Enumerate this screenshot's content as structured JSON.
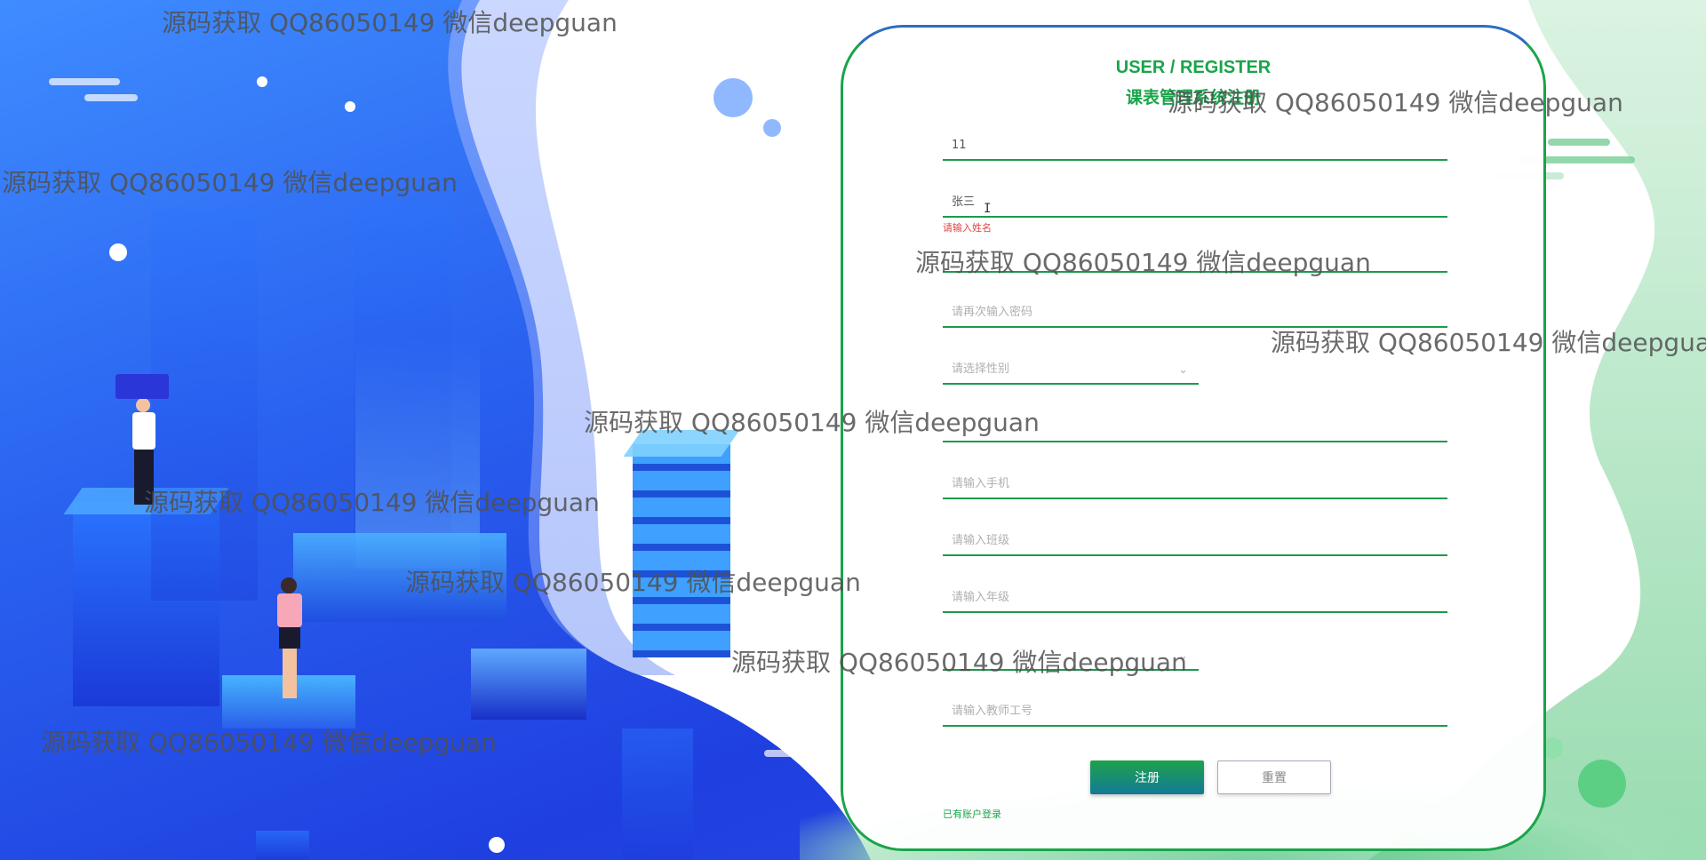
{
  "card": {
    "title_en": "USER / REGISTER",
    "title_cn": "课表管理系统注册"
  },
  "form": {
    "account": {
      "value": "11"
    },
    "name": {
      "value": "张三",
      "error": "请输入姓名"
    },
    "password": {
      "placeholder": ""
    },
    "password_confirm": {
      "placeholder": "请再次输入密码"
    },
    "gender": {
      "placeholder": "请选择性别",
      "chevron": "chevron-down-icon"
    },
    "email": {
      "placeholder": ""
    },
    "phone": {
      "placeholder": "请输入手机"
    },
    "class": {
      "placeholder": "请输入班级"
    },
    "grade": {
      "placeholder": "请输入年级"
    },
    "role_select": {
      "placeholder": "",
      "chevron": "chevron-down-icon"
    },
    "teacher_no": {
      "placeholder": "请输入教师工号"
    }
  },
  "buttons": {
    "submit": "注册",
    "reset": "重置"
  },
  "login_link": "已有账户登录",
  "cursor_glyph": "I",
  "watermark_text": "源码获取 QQ86050149 微信deepguan",
  "colors": {
    "accent_green": "#1aa44a",
    "error_red": "#e04545",
    "bg_blue": "#2a63f0"
  }
}
